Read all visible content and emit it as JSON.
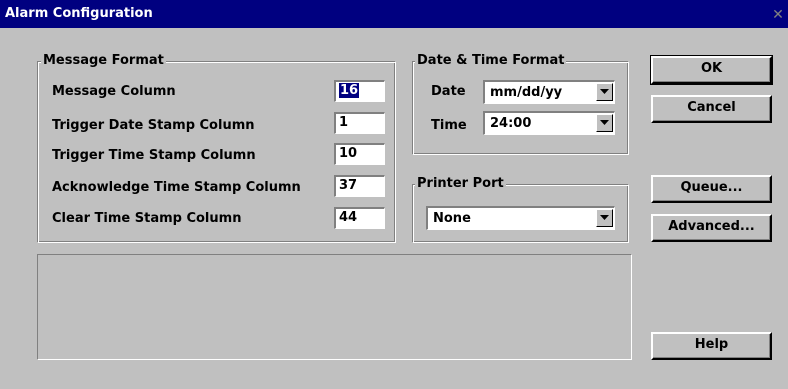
{
  "window": {
    "title": "Alarm Configuration",
    "close_symbol": "✕"
  },
  "message_format": {
    "legend": "Message Format",
    "rows": [
      {
        "label": "Message Column",
        "value": "16"
      },
      {
        "label": "Trigger Date Stamp Column",
        "value": "1"
      },
      {
        "label": "Trigger Time Stamp Column",
        "value": "10"
      },
      {
        "label": "Acknowledge Time Stamp Column",
        "value": "37"
      },
      {
        "label": "Clear Time Stamp Column",
        "value": "44"
      }
    ]
  },
  "date_time_format": {
    "legend": "Date & Time Format",
    "date_label": "Date",
    "date_value": "mm/dd/yy",
    "time_label": "Time",
    "time_value": "24:00"
  },
  "printer_port": {
    "legend": "Printer Port",
    "value": "None"
  },
  "buttons": {
    "ok": "OK",
    "cancel": "Cancel",
    "queue": "Queue...",
    "advanced": "Advanced...",
    "help": "Help"
  }
}
